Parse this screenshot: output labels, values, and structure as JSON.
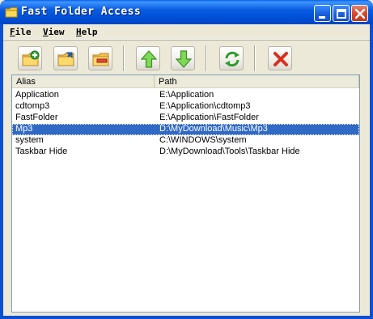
{
  "window": {
    "title": "Fast Folder Access",
    "title_icon": "folder-icon",
    "controls": [
      "minimize-icon",
      "maximize-icon",
      "close-icon"
    ]
  },
  "menu": [
    {
      "label": "File",
      "mnemonic": "F"
    },
    {
      "label": "View",
      "mnemonic": "V"
    },
    {
      "label": "Help",
      "mnemonic": "H"
    }
  ],
  "toolbar": {
    "buttons": [
      {
        "name": "add-folder-button",
        "icon": "folder-add-icon"
      },
      {
        "name": "edit-folder-button",
        "icon": "folder-edit-icon"
      },
      {
        "name": "remove-folder-button",
        "icon": "folder-remove-icon"
      },
      {
        "name": "move-up-button",
        "icon": "arrow-up-icon"
      },
      {
        "name": "move-down-button",
        "icon": "arrow-down-icon"
      },
      {
        "name": "refresh-button",
        "icon": "refresh-icon"
      },
      {
        "name": "delete-button",
        "icon": "red-x-icon"
      }
    ]
  },
  "list": {
    "columns": [
      "Alias",
      "Path"
    ],
    "rows": [
      {
        "alias": "Application",
        "path": "E:\\Application",
        "selected": false
      },
      {
        "alias": "cdtomp3",
        "path": "E:\\Application\\cdtomp3",
        "selected": false
      },
      {
        "alias": "FastFolder",
        "path": "E:\\Application\\FastFolder",
        "selected": false
      },
      {
        "alias": "Mp3",
        "path": "D:\\MyDownload\\Music\\Mp3",
        "selected": true
      },
      {
        "alias": "system",
        "path": "C:\\WINDOWS\\system",
        "selected": false
      },
      {
        "alias": "Taskbar Hide",
        "path": "D:\\MyDownload\\Tools\\Taskbar Hide",
        "selected": false
      }
    ]
  },
  "colors": {
    "title_bar": "#0054e3",
    "selection": "#316ac5",
    "face": "#ece9d8"
  }
}
